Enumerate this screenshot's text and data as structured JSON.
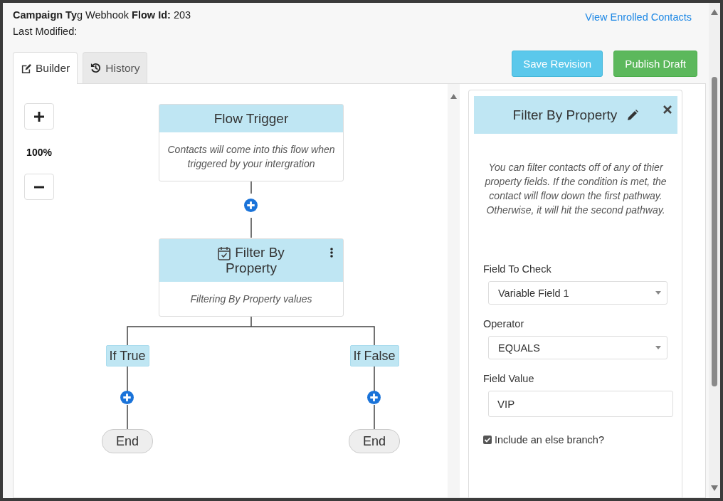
{
  "header": {
    "title_line": "**Campaign Ty**g Webhook **Flow Id:** 203",
    "last_modified": "Last Modified:",
    "link": "View Enrolled Contacts"
  },
  "tabs": [
    {
      "label": "Builder",
      "selected": true
    },
    {
      "label": "History",
      "selected": false
    }
  ],
  "buttons": [
    {
      "label": "Save Revision",
      "kind": "info"
    },
    {
      "label": "Publish Draft",
      "kind": "success"
    }
  ],
  "zoom_text": "100%",
  "flow": {
    "nodes": [
      {
        "kind": "trigger",
        "title": "Flow Trigger",
        "description": "Contacts will come into this flow when triggered by your intergration"
      },
      {
        "kind": "filter",
        "title": "Filter By Property",
        "description": "Filtering By Property values"
      }
    ],
    "branches": [
      {
        "label": "If True",
        "end": "End"
      },
      {
        "label": "If False",
        "end": "End"
      }
    ]
  },
  "panel": {
    "title": "Filter By Property",
    "description": "You can filter contacts off of any of thier property fields. If the condition is met, the contact will flow down the first pathway. Otherwise, it will hit the second pathway.",
    "fields": [
      {
        "kind": "select",
        "label": "Field To Check",
        "value": "Variable Field 1"
      },
      {
        "kind": "select",
        "label": "Operator",
        "value": "EQUALS"
      },
      {
        "kind": "text",
        "label": "Field Value",
        "value": "VIP"
      }
    ],
    "else_branch": {
      "label": "Include an else branch?",
      "checked": true
    }
  }
}
